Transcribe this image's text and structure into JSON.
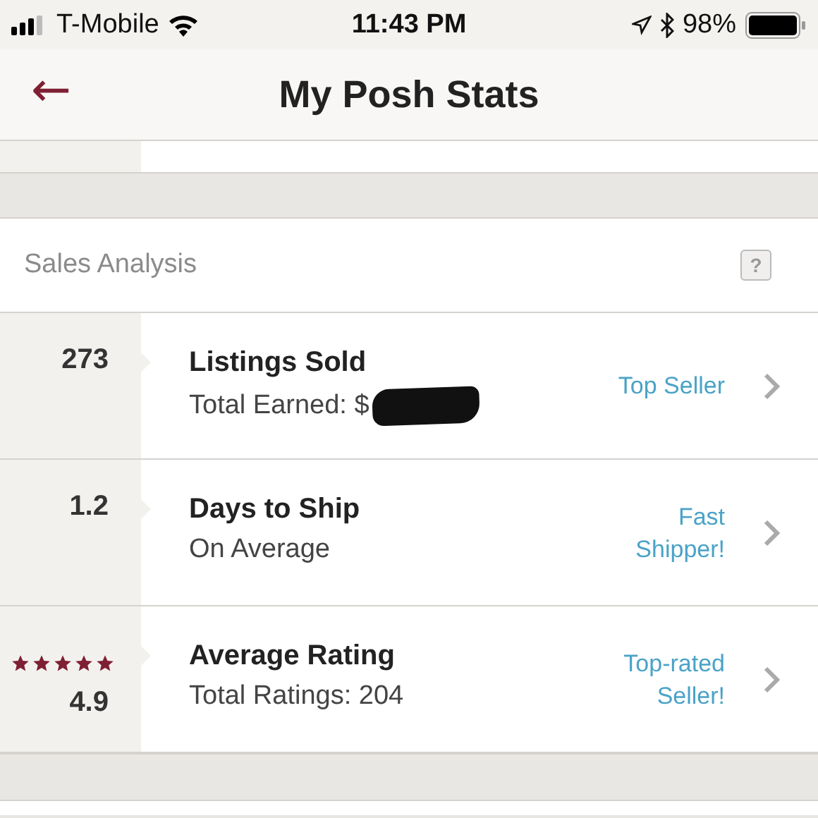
{
  "status_bar": {
    "carrier": "T-Mobile",
    "time": "11:43 PM",
    "battery": "98%"
  },
  "nav": {
    "back": "←",
    "title": "My Posh Stats"
  },
  "section": {
    "title": "Sales Analysis",
    "help": "?"
  },
  "stats": [
    {
      "value": "273",
      "title": "Listings Sold",
      "subtitle": "Total Earned: $",
      "redacted": true,
      "badge": "Top Seller"
    },
    {
      "value": "1.2",
      "title": "Days to Ship",
      "subtitle": "On Average",
      "redacted": false,
      "badge": "Fast Shipper!"
    },
    {
      "value": "4.9",
      "stars": 5,
      "title": "Average Rating",
      "subtitle": "Total Ratings: 204",
      "redacted": false,
      "badge": "Top-rated Seller!"
    }
  ]
}
